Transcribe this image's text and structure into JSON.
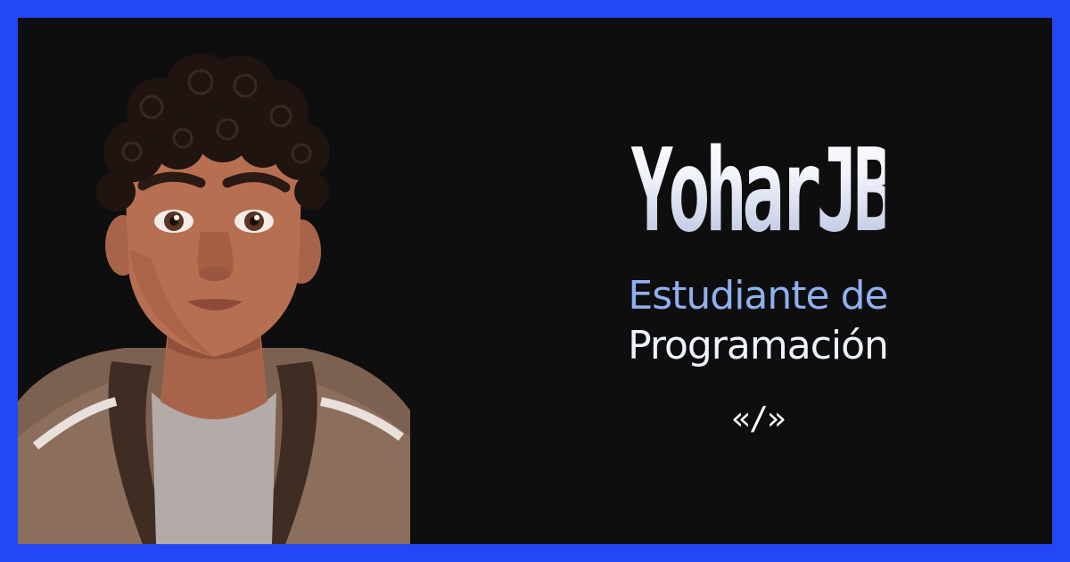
{
  "profile": {
    "name": "YoharJB",
    "subtitle_line1": "Estudiante de",
    "subtitle_line2": "Programación",
    "code_symbol": "«/»"
  },
  "icons": {
    "avatar": "avatar-illustration",
    "code": "code-brackets-icon"
  },
  "colors": {
    "border": "#2447f5",
    "background": "#0e0e0f",
    "subtitle_accent": "#8fb0f0",
    "subtitle_light": "#eef3fc"
  }
}
